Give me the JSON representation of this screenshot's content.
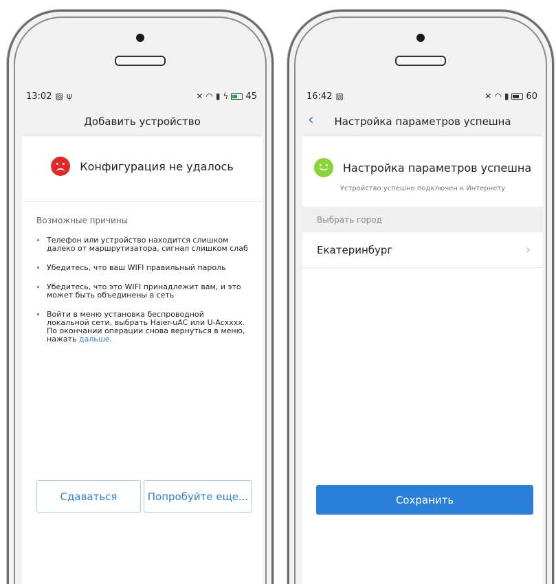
{
  "left_phone": {
    "status": {
      "time": "13:02",
      "battery": "45"
    },
    "title": "Добавить устройство",
    "result_text": "Конфигурация не удалось",
    "reasons_title": "Возможные причины",
    "reasons": [
      "Телефон или устройство находится слишком далеко от маршрутизатора, сигнал слишком слаб",
      "Убедитесь, что ваш WIFI правильный пароль",
      "Убедитесь, что это WIFI принадлежит вам, и это может быть объединены в сеть"
    ],
    "reason_last_text": "Войти в меню установка беспроводной локальной сети, выбрать Haier-uAC или U-Acxxxx. По окончании операции снова вернуться в меню, нажать ",
    "reason_last_link": "дальше.",
    "btn_giveup": "Сдаваться",
    "btn_retry": "Попробуйте еще..."
  },
  "right_phone": {
    "status": {
      "time": "16:42",
      "battery": "60"
    },
    "title": "Настройка параметров успешна",
    "result_text": "Настройка параметров успешна",
    "subtext": "Устройство успешно подключен к Интернету",
    "section_label": "Выбрать город",
    "city": "Екатеринбург",
    "btn_save": "Сохранить"
  },
  "colors": {
    "accent": "#2a7fd9",
    "error": "#e32626",
    "success": "#8ad33a",
    "battery_charging": "#1ea548"
  },
  "icons": {
    "sad_face": "sad-face-icon",
    "happy_face": "happy-face-icon",
    "back": "chevron-left-icon",
    "row_chevron": "chevron-right-icon",
    "image": "image-icon",
    "usb": "usb-icon",
    "mute": "mute-icon",
    "wifi": "wifi-icon",
    "signal": "signal-icon",
    "charging": "charging-icon",
    "battery": "battery-icon"
  }
}
